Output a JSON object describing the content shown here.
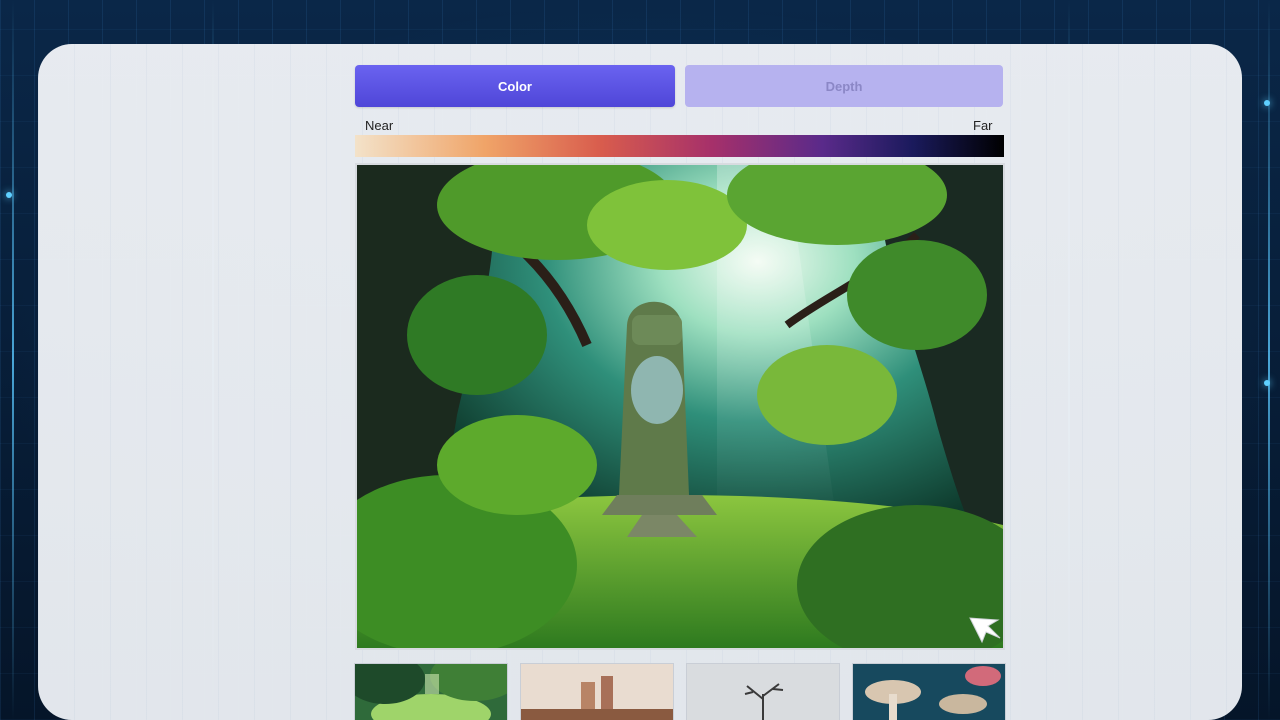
{
  "toggle": {
    "color_label": "Color",
    "depth_label": "Depth",
    "active": "Color",
    "active_color": "#5b53e6",
    "inactive_color": "#b6b2ef"
  },
  "depth_scale": {
    "near_label": "Near",
    "far_label": "Far",
    "gradient_colors": [
      "#f3e2c9",
      "#f0a468",
      "#d85c4d",
      "#a6306a",
      "#5a2a8a",
      "#1a1a5c",
      "#000000"
    ]
  },
  "main_view": {
    "icon": "jungle-statue-image"
  },
  "thumbnails": [
    {
      "icon": "forest-thumbnail"
    },
    {
      "icon": "ruins-thumbnail"
    },
    {
      "icon": "bare-tree-thumbnail"
    },
    {
      "icon": "mushroom-thumbnail"
    }
  ],
  "cursor": {
    "icon": "mouse-pointer-icon"
  }
}
